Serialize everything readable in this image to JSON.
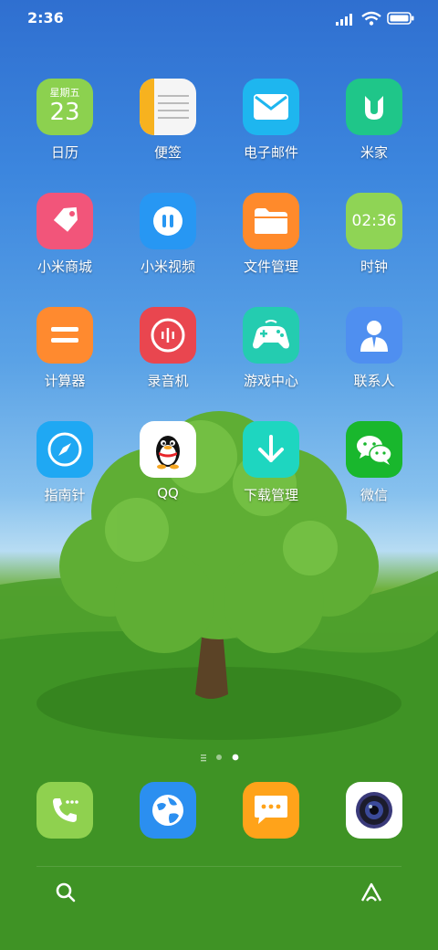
{
  "status_bar": {
    "time": "2:36"
  },
  "apps": [
    {
      "label": "日历",
      "calendar_weekday": "星期五",
      "calendar_day": "23"
    },
    {
      "label": "便签"
    },
    {
      "label": "电子邮件"
    },
    {
      "label": "米家"
    },
    {
      "label": "小米商城"
    },
    {
      "label": "小米视频"
    },
    {
      "label": "文件管理"
    },
    {
      "label": "时钟",
      "clock_text": "02:36"
    },
    {
      "label": "计算器"
    },
    {
      "label": "录音机"
    },
    {
      "label": "游戏中心"
    },
    {
      "label": "联系人"
    },
    {
      "label": "指南针"
    },
    {
      "label": "QQ"
    },
    {
      "label": "下载管理"
    },
    {
      "label": "微信"
    }
  ],
  "page_indicator": {
    "pages": 3,
    "current": 3
  },
  "dock": [
    "phone-icon",
    "browser-icon",
    "messages-icon",
    "camera-icon"
  ],
  "colors": {
    "calendar": "#8cd14f",
    "notes": "#f5f5f5",
    "email": "#1eb6ef",
    "mijia": "#1fc689",
    "mall": "#f2557a",
    "video": "#2797f3",
    "files": "#ff8a2b",
    "clock": "#8fd455",
    "calculator": "#ff8a2f",
    "recorder": "#e9464f",
    "game": "#24ccb0",
    "contacts": "#4f8ff0",
    "compass": "#1fa8f3",
    "qq": "#ffffff",
    "download": "#1ed6c0",
    "wechat": "#19b72d"
  }
}
